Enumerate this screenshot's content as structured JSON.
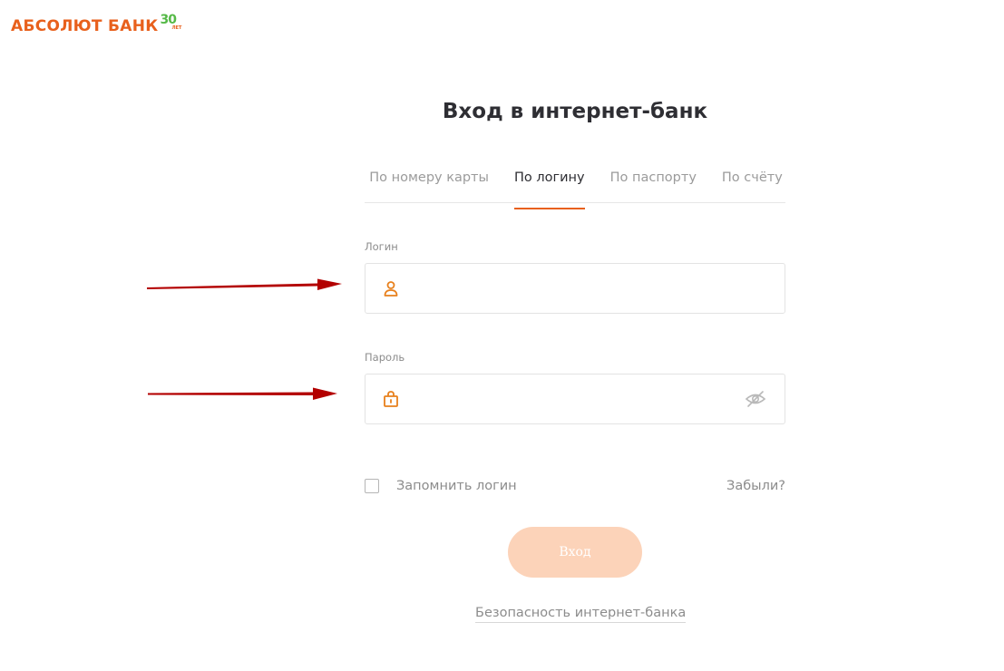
{
  "logo": {
    "text": "АБСОЛЮТ БАНК",
    "badge_number": "30",
    "badge_sub": "ЛЕТ"
  },
  "title": "Вход в интернет-банк",
  "tabs": [
    {
      "label": "По номеру карты",
      "active": false
    },
    {
      "label": "По логину",
      "active": true
    },
    {
      "label": "По паспорту",
      "active": false
    },
    {
      "label": "По счёту",
      "active": false
    }
  ],
  "login_field": {
    "label": "Логин",
    "value": "",
    "placeholder": "",
    "icon": "user-icon"
  },
  "password_field": {
    "label": "Пароль",
    "value": "",
    "placeholder": "",
    "icon": "lock-icon",
    "toggle_icon": "eye-hidden-icon"
  },
  "remember": {
    "label": "Запомнить логин",
    "checked": false
  },
  "forgot_label": "Забыли?",
  "submit_label": "Вход",
  "security_link": "Безопасность интернет-банка",
  "colors": {
    "brand_orange": "#e8601c",
    "brand_green": "#55b947",
    "button_disabled": "#fcd3b9",
    "annotation_arrow": "#b30000"
  }
}
